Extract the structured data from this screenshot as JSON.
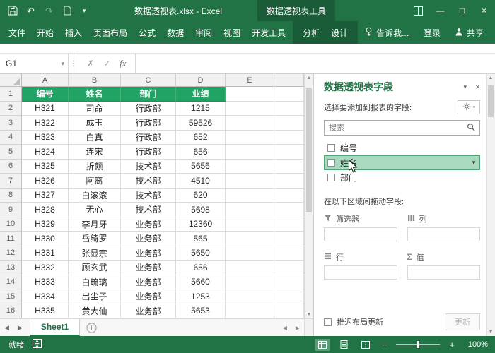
{
  "colors": {
    "excel_green": "#217346",
    "contextual_green": "#1a5c38",
    "table_header_fill": "#21a366",
    "field_highlight_fill": "#a9d9bf"
  },
  "glyphs": {
    "dropdown": "▾",
    "close": "×",
    "minimize": "—",
    "maximize": "□",
    "undo": "↶",
    "redo": "↷",
    "dots": "⋮",
    "cancel": "✗",
    "enter": "✓",
    "up": "▲",
    "down": "▼",
    "left": "◀",
    "right": "▶"
  },
  "titlebar": {
    "title": "数据透视表.xlsx - Excel",
    "contextual_tools_label": "数据透视表工具"
  },
  "ribbon": {
    "tabs": [
      {
        "name": "file",
        "label": "文件"
      },
      {
        "name": "home",
        "label": "开始"
      },
      {
        "name": "insert",
        "label": "插入"
      },
      {
        "name": "page-layout",
        "label": "页面布局"
      },
      {
        "name": "formulas",
        "label": "公式"
      },
      {
        "name": "data",
        "label": "数据"
      },
      {
        "name": "review",
        "label": "审阅"
      },
      {
        "name": "view",
        "label": "视图"
      },
      {
        "name": "developer",
        "label": "开发工具"
      }
    ],
    "contextual_tabs": [
      {
        "name": "analyze",
        "label": "分析"
      },
      {
        "name": "design",
        "label": "设计"
      }
    ],
    "tell_me_label": "告诉我...",
    "sign_in_label": "登录",
    "share_label": "共享"
  },
  "formula_bar": {
    "name_box_value": "G1",
    "fx_label": "fx",
    "formula_value": ""
  },
  "grid": {
    "column_headers": [
      "A",
      "B",
      "C",
      "D",
      "E",
      ""
    ],
    "rows": [
      {
        "num": "1",
        "style": "header",
        "cells": [
          "编号",
          "姓名",
          "部门",
          "业绩"
        ]
      },
      {
        "num": "2",
        "style": "data",
        "cells": [
          "H321",
          "司命",
          "行政部",
          "1215"
        ]
      },
      {
        "num": "3",
        "style": "data",
        "cells": [
          "H322",
          "成玉",
          "行政部",
          "59526"
        ]
      },
      {
        "num": "4",
        "style": "data",
        "cells": [
          "H323",
          "白真",
          "行政部",
          "652"
        ]
      },
      {
        "num": "5",
        "style": "data",
        "cells": [
          "H324",
          "连宋",
          "行政部",
          "656"
        ]
      },
      {
        "num": "6",
        "style": "data",
        "cells": [
          "H325",
          "折颜",
          "技术部",
          "5656"
        ]
      },
      {
        "num": "7",
        "style": "data",
        "cells": [
          "H326",
          "阿离",
          "技术部",
          "4510"
        ]
      },
      {
        "num": "8",
        "style": "data",
        "cells": [
          "H327",
          "白滚滚",
          "技术部",
          "620"
        ]
      },
      {
        "num": "9",
        "style": "data",
        "cells": [
          "H328",
          "无心",
          "技术部",
          "5698"
        ]
      },
      {
        "num": "10",
        "style": "data",
        "cells": [
          "H329",
          "李月牙",
          "业务部",
          "12360"
        ]
      },
      {
        "num": "11",
        "style": "data",
        "cells": [
          "H330",
          "岳绮罗",
          "业务部",
          "565"
        ]
      },
      {
        "num": "12",
        "style": "data",
        "cells": [
          "H331",
          "张显宗",
          "业务部",
          "5650"
        ]
      },
      {
        "num": "13",
        "style": "data",
        "cells": [
          "H332",
          "顾玄武",
          "业务部",
          "656"
        ]
      },
      {
        "num": "14",
        "style": "data",
        "cells": [
          "H333",
          "白琉璃",
          "业务部",
          "5660"
        ]
      },
      {
        "num": "15",
        "style": "data",
        "cells": [
          "H334",
          "出尘子",
          "业务部",
          "1253"
        ]
      },
      {
        "num": "16",
        "style": "data",
        "cells": [
          "H335",
          "黄大仙",
          "业务部",
          "5653"
        ]
      }
    ]
  },
  "sheet_bar": {
    "active_tab": "Sheet1"
  },
  "task_pane": {
    "title": "数据透视表字段",
    "choose_label": "选择要添加到报表的字段:",
    "search_placeholder": "搜索",
    "field_dropdown_icon": "▼",
    "fields": [
      {
        "name": "number",
        "label": "编号",
        "checked": false,
        "highlighted": false
      },
      {
        "name": "name",
        "label": "姓名",
        "checked": false,
        "highlighted": true
      },
      {
        "name": "department",
        "label": "部门",
        "checked": false,
        "highlighted": false
      }
    ],
    "drag_label": "在以下区域间拖动字段:",
    "areas": [
      {
        "name": "filters",
        "label": "筛选器"
      },
      {
        "name": "columns",
        "label": "列"
      },
      {
        "name": "rows",
        "label": "行"
      },
      {
        "name": "values",
        "label": "值"
      }
    ],
    "defer_label": "推迟布局更新",
    "update_label": "更新"
  },
  "status_bar": {
    "ready_label": "就绪",
    "zoom_minus": "−",
    "zoom_plus": "+",
    "zoom_level": "100%"
  }
}
